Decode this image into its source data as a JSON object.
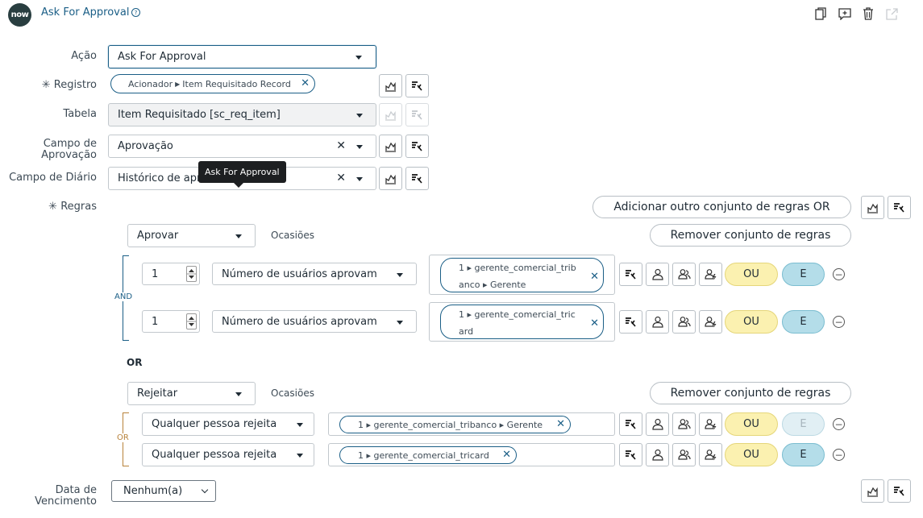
{
  "header": {
    "logo": "now",
    "title": "Ask For Approval",
    "help": "?"
  },
  "form": {
    "acao": {
      "label": "Ação",
      "value": "Ask For Approval"
    },
    "registro": {
      "label": "Registro",
      "pill_a": "Acionador",
      "pill_b": "Item Requisitado Record"
    },
    "tabela": {
      "label": "Tabela",
      "value": "Item Requisitado [sc_req_item]"
    },
    "campo_aprovacao": {
      "label_1": "Campo de",
      "label_2": "Aprovação",
      "value": "Aprovação"
    },
    "campo_diario": {
      "label": "Campo de Diário",
      "value": "Histórico de apr"
    },
    "regras": {
      "label": "Regras"
    },
    "vencimento": {
      "label_1": "Data de",
      "label_2": "Vencimento",
      "value": "Nenhum(a)"
    }
  },
  "tooltip": "Ask For Approval",
  "rules": {
    "add_or_set": "Adicionar outro conjunto de regras OR",
    "remove_set": "Remover conjunto de regras",
    "occasions": "Ocasiões",
    "and_label": "AND",
    "or_label": "OR",
    "or_separator": "OR",
    "ou": "OU",
    "e": "E",
    "set1": {
      "action": "Aprovar",
      "rows": [
        {
          "count": "1",
          "condition": "Número de usuários aprovam",
          "pill_line1": "1 ▸ gerente_comercial_trib",
          "pill_line2": "anco ▸ Gerente"
        },
        {
          "count": "1",
          "condition": "Número de usuários aprovam",
          "pill_line1": "1 ▸ gerente_comercial_tric",
          "pill_line2": "ard"
        }
      ]
    },
    "set2": {
      "action": "Rejeitar",
      "rows": [
        {
          "condition": "Qualquer pessoa rejeita",
          "pill": "1 ▸ gerente_comercial_tribanco ▸ Gerente"
        },
        {
          "condition": "Qualquer pessoa rejeita",
          "pill": "1 ▸ gerente_comercial_tricard"
        }
      ]
    }
  },
  "colors": {
    "brand": "#293e40",
    "accent": "#1a5e86",
    "ou": "#fbf1b0",
    "e": "#b4dde9",
    "or_bracket": "#b8823a"
  }
}
